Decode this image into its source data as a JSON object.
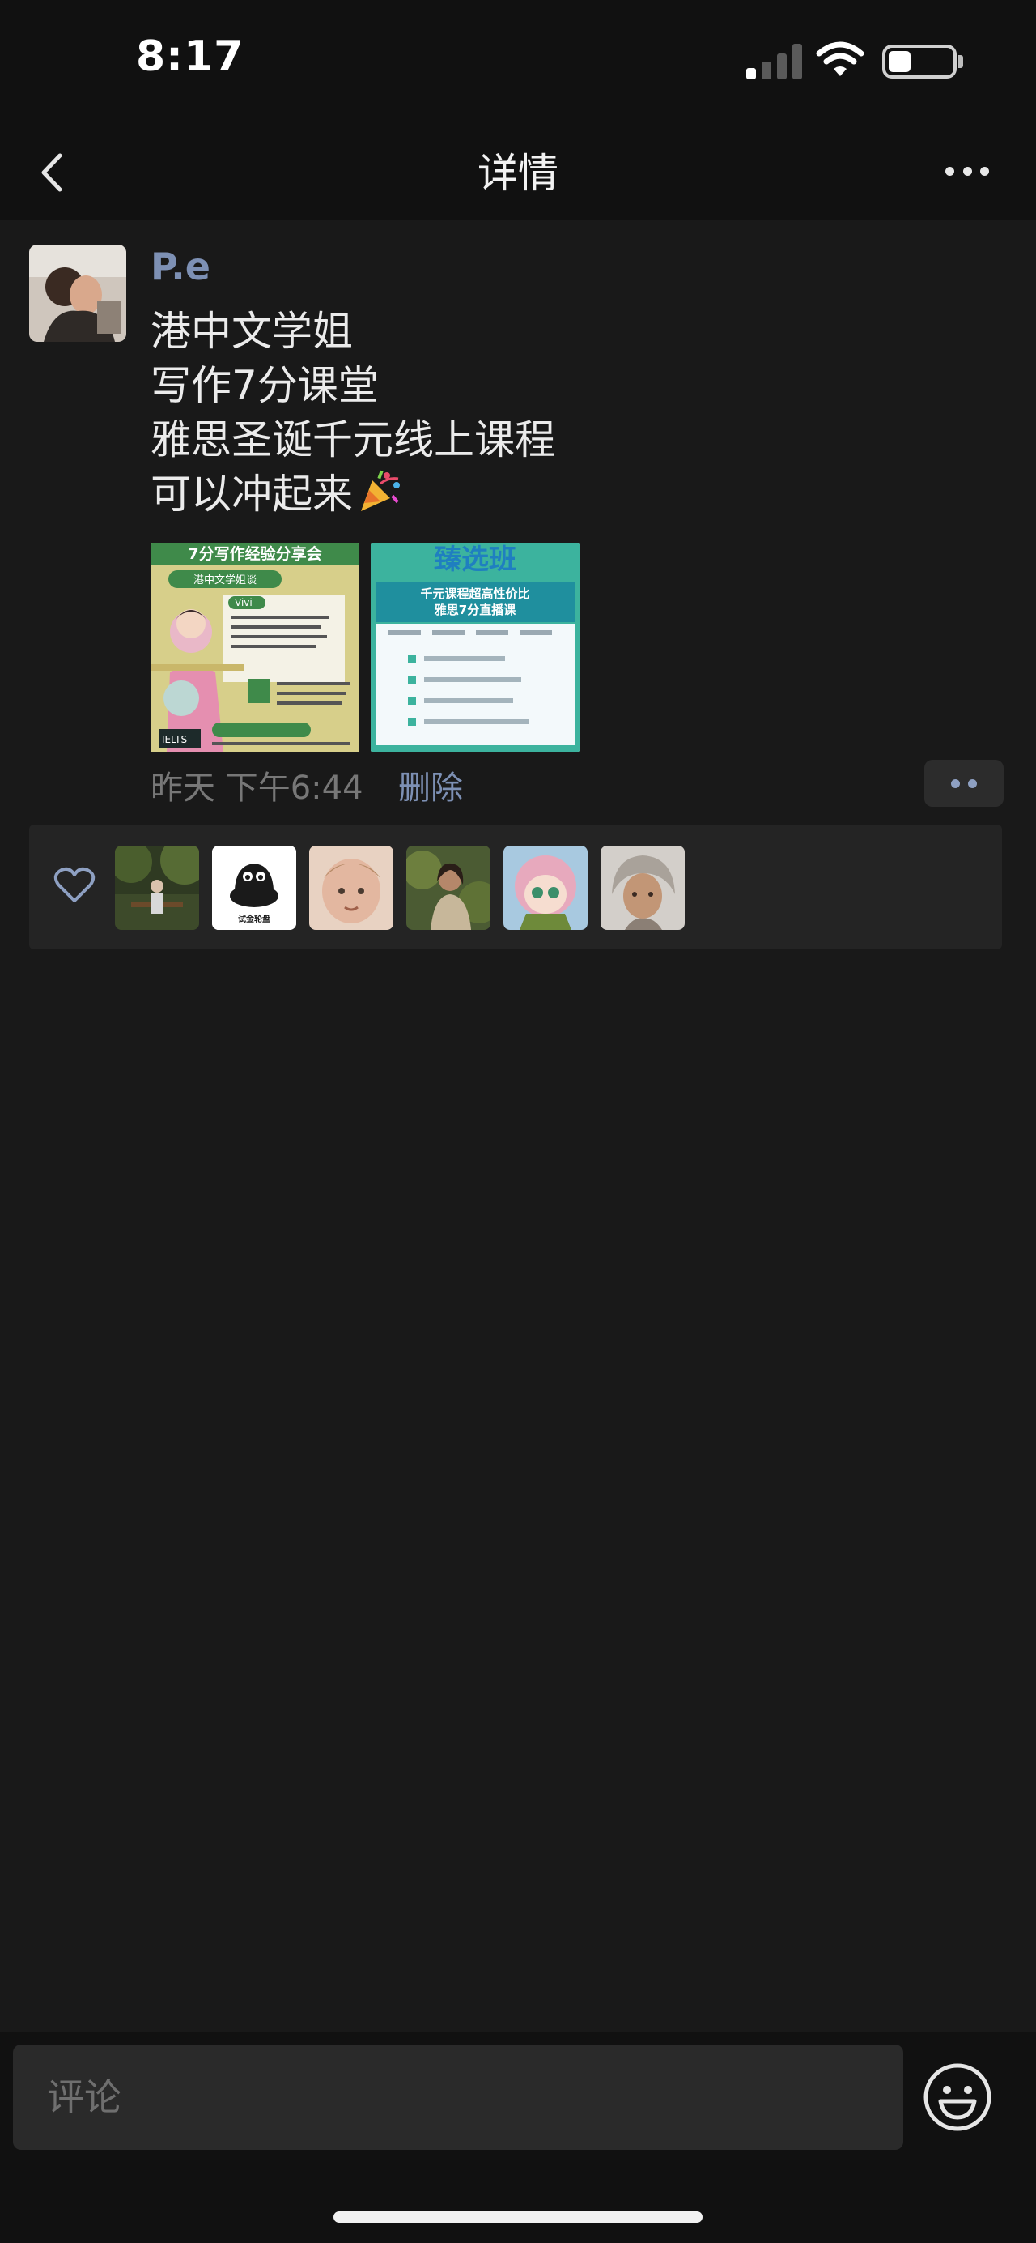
{
  "status_bar": {
    "time": "8:17",
    "battery_fraction": 0.35
  },
  "nav": {
    "title": "详情"
  },
  "post": {
    "author": "P.e",
    "lines": [
      "港中文学姐",
      "写作7分课堂",
      "雅思圣诞千元线上课程",
      "可以冲起来"
    ],
    "trailing_emoji": "party-popper-icon",
    "images": [
      {
        "title": "7分写作经验分享会",
        "tag": "港中文学姐谈",
        "name": "Vivi",
        "badge": "IELTS"
      },
      {
        "title": "臻选班",
        "subtitle": "千元课程超高性价比",
        "subtitle2": "雅思7分直播课"
      }
    ],
    "timestamp": "昨天  下午6:44",
    "delete_label": "删除"
  },
  "likes": {
    "avatars": [
      {
        "name": "like-avatar-1",
        "color": "#3d4a2a"
      },
      {
        "name": "like-avatar-2",
        "color": "#ffffff",
        "label": "试金轮盘"
      },
      {
        "name": "like-avatar-3",
        "color": "#d9b7a3"
      },
      {
        "name": "like-avatar-4",
        "color": "#4b5b33"
      },
      {
        "name": "like-avatar-5",
        "color": "#d7a7b6"
      },
      {
        "name": "like-avatar-6",
        "color": "#c9c3bd"
      }
    ]
  },
  "comment": {
    "placeholder": "评论"
  },
  "colors": {
    "link": "#7d90b4",
    "background": "#191919",
    "bar": "#111111"
  }
}
